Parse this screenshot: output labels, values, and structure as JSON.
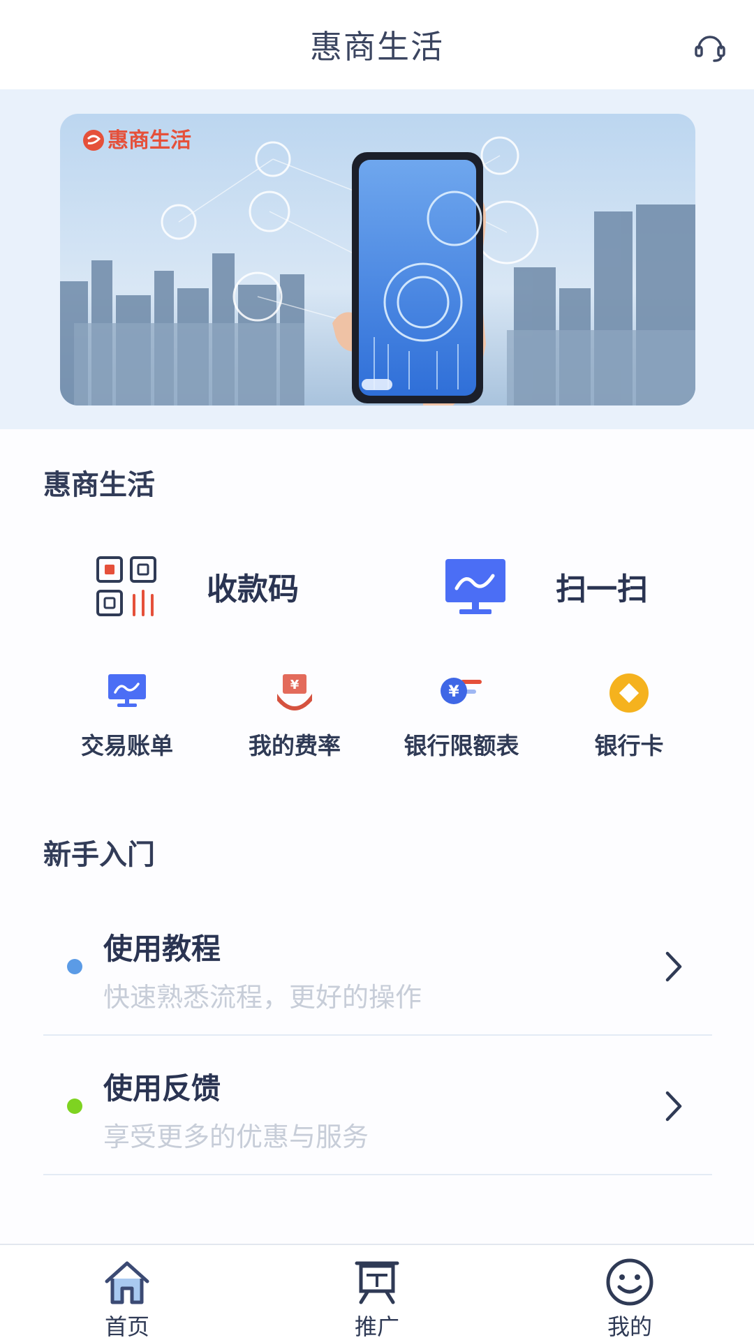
{
  "header": {
    "title": "惠商生活",
    "support_icon": "headset-icon"
  },
  "banner": {
    "logo_text": "惠商生活",
    "brand_color": "#e5503a"
  },
  "section_main": {
    "title": "惠商生活",
    "big_actions": [
      {
        "label": "收款码",
        "icon": "qr-code-icon"
      },
      {
        "label": "扫一扫",
        "icon": "monitor-chart-icon"
      }
    ],
    "grid": [
      {
        "label": "交易账单",
        "icon": "monitor-chart-icon"
      },
      {
        "label": "我的费率",
        "icon": "yen-hand-icon"
      },
      {
        "label": "银行限额表",
        "icon": "yen-coin-icon"
      },
      {
        "label": "银行卡",
        "icon": "diamond-coin-icon"
      }
    ]
  },
  "section_guide": {
    "title": "新手入门",
    "items": [
      {
        "title": "使用教程",
        "subtitle": "快速熟悉流程，更好的操作",
        "dot_color": "#5b9be6"
      },
      {
        "title": "使用反馈",
        "subtitle": "享受更多的优惠与服务",
        "dot_color": "#7ed321"
      }
    ]
  },
  "tabbar": {
    "tabs": [
      {
        "label": "首页",
        "icon": "home-icon",
        "active": true
      },
      {
        "label": "推广",
        "icon": "presentation-icon",
        "active": false
      },
      {
        "label": "我的",
        "icon": "smiley-icon",
        "active": false
      }
    ]
  },
  "colors": {
    "accent": "#4b6ef5",
    "text_dark": "#2a3452",
    "text_muted": "#c7cdd8",
    "banner_bg": "#e9f1fb"
  }
}
